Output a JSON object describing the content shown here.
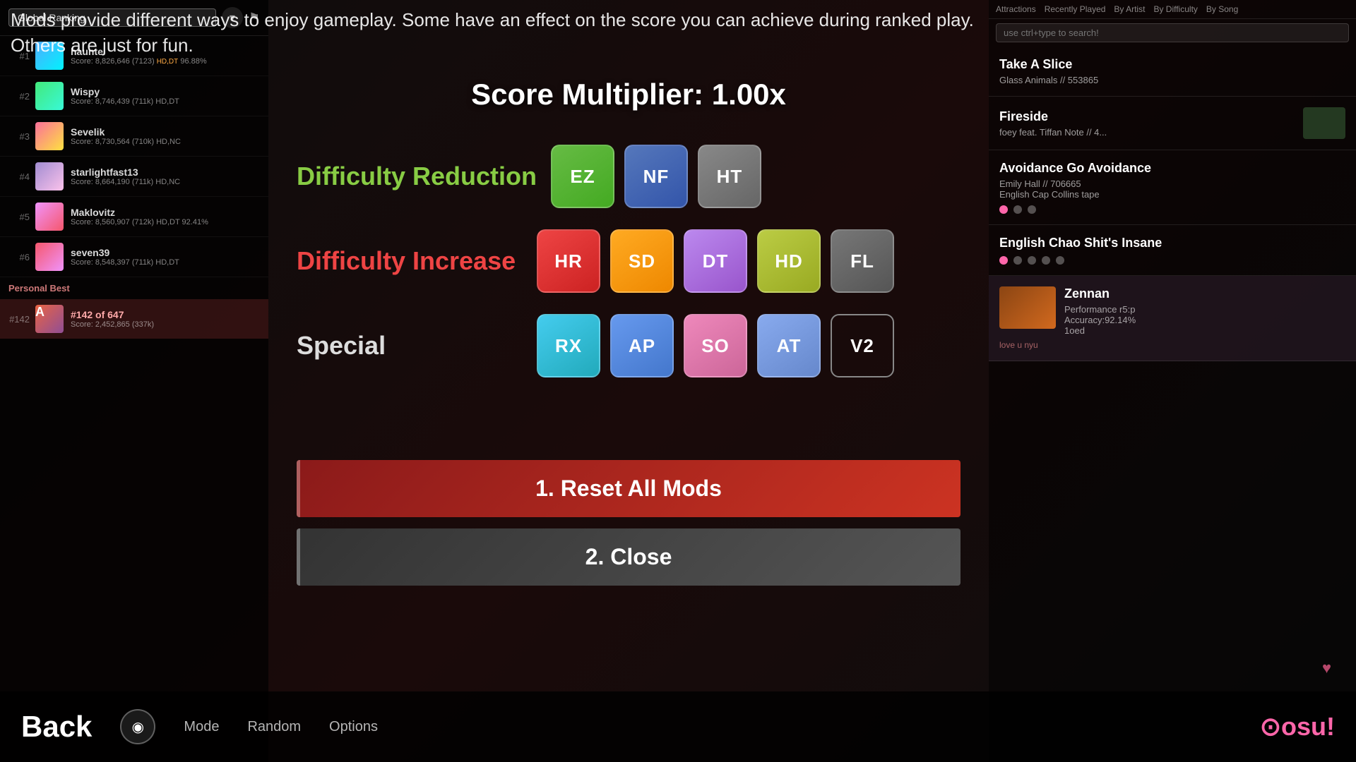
{
  "description": {
    "text": "Mods provide different ways to enjoy gameplay. Some have an effect on the score you can achieve during ranked play. Others are just for fun."
  },
  "score_multiplier": {
    "label": "Score Multiplier: 1.00x"
  },
  "categories": {
    "reduction": "Difficulty Reduction",
    "increase": "Difficulty Increase",
    "special": "Special"
  },
  "mods": {
    "reduction": [
      {
        "id": "ez",
        "label": "EZ",
        "class": "ez"
      },
      {
        "id": "nf",
        "label": "NF",
        "class": "nf"
      },
      {
        "id": "ht",
        "label": "HT",
        "class": "ht"
      }
    ],
    "increase": [
      {
        "id": "hr",
        "label": "HR",
        "class": "hr"
      },
      {
        "id": "sd",
        "label": "SD",
        "class": "sd"
      },
      {
        "id": "dt",
        "label": "DT",
        "class": "dt"
      },
      {
        "id": "hd",
        "label": "HD",
        "class": "hd"
      },
      {
        "id": "fl",
        "label": "FL",
        "class": "fl"
      }
    ],
    "special": [
      {
        "id": "rx",
        "label": "RX",
        "class": "rx"
      },
      {
        "id": "ap",
        "label": "AP",
        "class": "ap"
      },
      {
        "id": "so",
        "label": "SO",
        "class": "so"
      },
      {
        "id": "at",
        "label": "AT",
        "class": "at"
      },
      {
        "id": "v2",
        "label": "V2",
        "class": "v2"
      }
    ]
  },
  "buttons": {
    "reset": "1. Reset All Mods",
    "close": "2. Close"
  },
  "bottom_bar": {
    "back": "Back",
    "mode": "Mode",
    "random": "Random",
    "options": "Options"
  },
  "leaderboard": {
    "ranking_label": "Global Ranking",
    "players": [
      {
        "name": "haunte",
        "score": "8,826,646",
        "rank": "7123",
        "avatar_class": "blue"
      },
      {
        "name": "Wispy",
        "score": "8,746,439",
        "rank": "711k",
        "avatar_class": "green"
      },
      {
        "name": "Sevelik",
        "score": "8,730,564",
        "rank": "710k",
        "avatar_class": "orange"
      },
      {
        "name": "starlightfast13",
        "score": "8,664,190",
        "rank": "711k",
        "avatar_class": "pink"
      },
      {
        "name": "Maklovitz",
        "score": "8,560,907",
        "rank": "712k",
        "avatar_class": "red"
      },
      {
        "name": "seven39",
        "score": "8,548,397",
        "rank": "711k",
        "avatar_class": "red2"
      },
      {
        "name": "#142 of 647",
        "score": "2,452,865",
        "rank": "337k",
        "avatar_class": "special",
        "personal_best": true
      }
    ],
    "personal_best_label": "Personal Best"
  },
  "right_panel": {
    "song1": {
      "title": "Take A Slice",
      "artist": "Glass Animals // 553865"
    },
    "song2": {
      "title": "Fireside",
      "artist": "Foey feat. Tiffan Note // 4..."
    },
    "song3": {
      "title": "Avoidance Go Avoidance",
      "artist": "Emily Hall // 706665"
    },
    "song3_sub": "English Cap Collins tape",
    "song4": {
      "title": "English Chao Shit's Insane",
      "artist": ""
    },
    "song5": {
      "title": "Zennan",
      "artist": "Performance r5:p"
    },
    "header_tabs": [
      "Attractions",
      "Recently Played",
      "By Artist",
      "By Difficulty",
      "By Song"
    ]
  },
  "colors": {
    "accent": "#ff66aa",
    "reduction": "#88cc44",
    "increase": "#ee4444",
    "special": "#dddddd",
    "reset_btn": "#8b1a1a",
    "close_btn": "#333333"
  }
}
